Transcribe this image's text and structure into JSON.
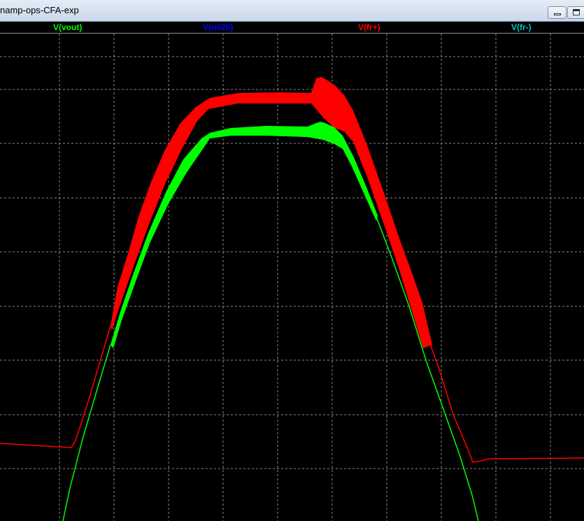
{
  "window": {
    "title": "namp-ops-CFA-exp",
    "minimize_icon": "minimize-icon",
    "restore_icon": "restore-icon"
  },
  "chart_data": {
    "type": "line",
    "title": "",
    "xlabel": "",
    "ylabel": "",
    "grid": true,
    "background": "#000000",
    "legend_placement": "top",
    "series": [
      {
        "name": "V(vout)",
        "color": "#00ff00"
      },
      {
        "name": "V(n026)",
        "color": "#0000ff"
      },
      {
        "name": "V(fr+)",
        "color": "#ff0000"
      },
      {
        "name": "V(fr-)",
        "color": "#00c8c8"
      }
    ]
  }
}
